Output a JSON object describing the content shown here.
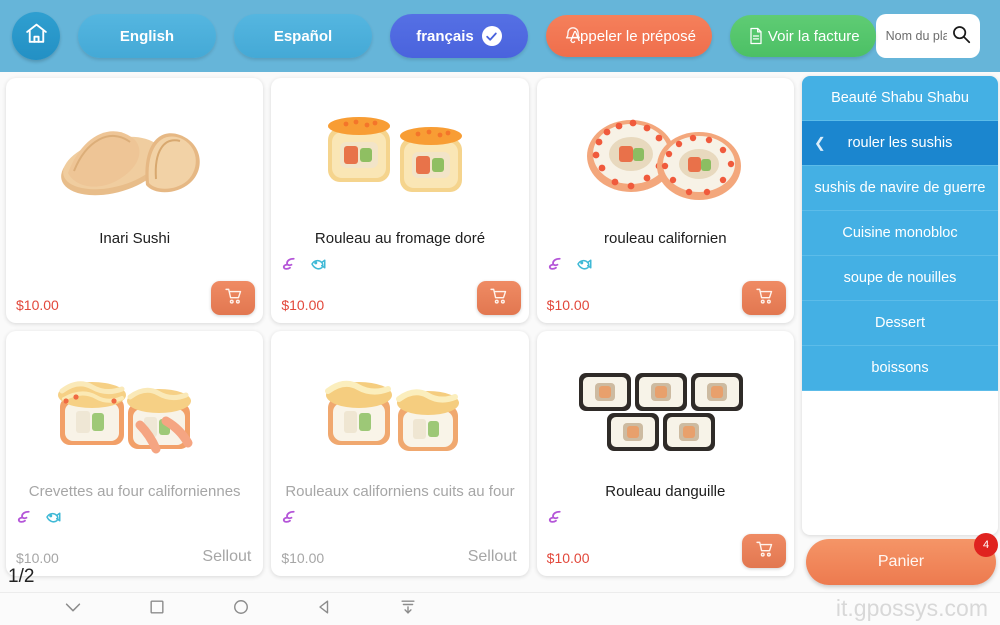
{
  "header": {
    "home_icon": "home-icon",
    "languages": [
      {
        "label": "English",
        "active": false
      },
      {
        "label": "Español",
        "active": false
      },
      {
        "label": "français",
        "active": true,
        "check_icon": "check-circle-icon"
      }
    ],
    "call_staff": {
      "label": "Appeler le préposé",
      "icon": "bell-icon",
      "color": "#ef6e4c"
    },
    "view_bill": {
      "label": "Voir la facture",
      "icon": "document-icon",
      "color": "#4cc065"
    },
    "search": {
      "placeholder": "Nom du plat Code n",
      "value": "",
      "icon": "search-icon"
    },
    "background_color": "#66b5d9"
  },
  "menu": {
    "items": [
      {
        "name": "Inari Sushi",
        "price": "$10.00",
        "tags": [],
        "soldout": false,
        "action_label": "",
        "cart_icon": "cart-icon",
        "image": "inari-sushi-image"
      },
      {
        "name": "Rouleau au fromage doré",
        "price": "$10.00",
        "tags": [
          "shrimp-icon",
          "fish-icon"
        ],
        "soldout": false,
        "action_label": "",
        "cart_icon": "cart-icon",
        "image": "cheese-roll-image"
      },
      {
        "name": "rouleau californien",
        "price": "$10.00",
        "tags": [
          "shrimp-icon",
          "fish-icon"
        ],
        "soldout": false,
        "action_label": "",
        "cart_icon": "cart-icon",
        "image": "california-roll-image"
      },
      {
        "name": "Crevettes au four californiennes",
        "price": "$10.00",
        "tags": [
          "shrimp-icon",
          "fish-icon"
        ],
        "soldout": true,
        "action_label": "Sellout",
        "cart_icon": "",
        "image": "baked-shrimp-image"
      },
      {
        "name": "Rouleaux californiens cuits au four",
        "price": "$10.00",
        "tags": [
          "shrimp-icon"
        ],
        "soldout": true,
        "action_label": "Sellout",
        "cart_icon": "",
        "image": "baked-california-roll-image"
      },
      {
        "name": "Rouleau danguille",
        "price": "$10.00",
        "tags": [
          "shrimp-icon"
        ],
        "soldout": false,
        "action_label": "",
        "cart_icon": "cart-icon",
        "image": "eel-roll-image"
      }
    ]
  },
  "sidebar": {
    "categories": [
      {
        "label": "Beauté Shabu Shabu",
        "active": false
      },
      {
        "label": "rouler les sushis",
        "active": true,
        "back_icon": "chevron-left-icon"
      },
      {
        "label": "sushis de navire de guerre",
        "active": false
      },
      {
        "label": "Cuisine monobloc",
        "active": false
      },
      {
        "label": "soupe de nouilles",
        "active": false
      },
      {
        "label": "Dessert",
        "active": false
      },
      {
        "label": "boissons",
        "active": false
      }
    ]
  },
  "cart": {
    "label": "Panier",
    "count": "4",
    "badge_color": "#e0231f"
  },
  "pagination": {
    "label": "1/2"
  },
  "navbar": {
    "icons": [
      "chevron-down-icon",
      "square-icon",
      "circle-icon",
      "triangle-back-icon",
      "download-icon"
    ]
  },
  "watermark": {
    "text": "it.gpossys.com"
  },
  "colors": {
    "header": "#66b5d9",
    "accent_orange": "#ef6e4c",
    "accent_green": "#4cc065",
    "accent_blue": "#44b0e4",
    "active_blue": "#1b86cf",
    "price_red": "#e2483b"
  }
}
